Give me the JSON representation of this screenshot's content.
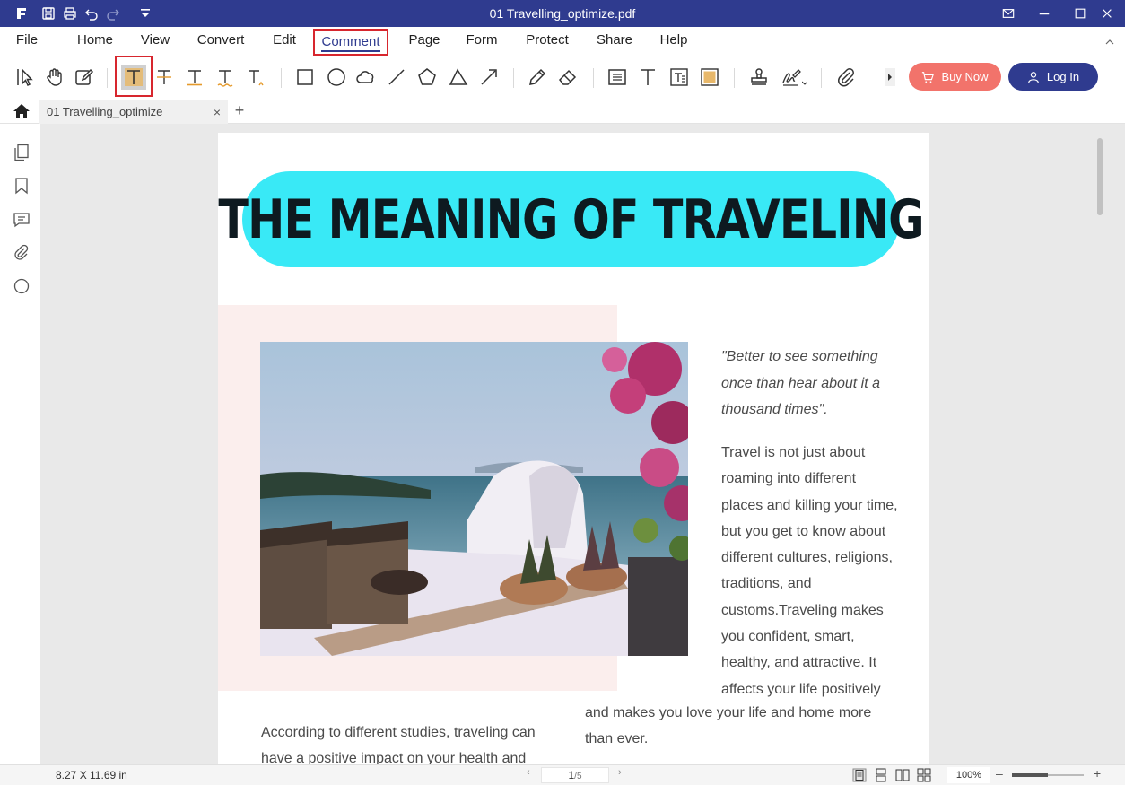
{
  "window": {
    "title": "01 Travelling_optimize.pdf"
  },
  "menu": {
    "items": [
      "File",
      "Home",
      "View",
      "Convert",
      "Edit",
      "Comment",
      "Page",
      "Form",
      "Protect",
      "Share",
      "Help"
    ],
    "active": "Comment"
  },
  "toolbar": {
    "buy_label": "Buy Now",
    "login_label": "Log In",
    "selected_tool": "highlight"
  },
  "tabs": {
    "doc_tab_label": "01 Travelling_optimize",
    "close_label": "×",
    "add_label": "+"
  },
  "document": {
    "headline": "THE MEANING OF TRAVELING",
    "quote": "\"Better to see something once than hear about it a thousand times\".",
    "para_right": "Travel is not just about roaming into different places and killing your time, but you get to know about different cultures, religions, traditions, and customs.Traveling makes you confident, smart, healthy, and attractive. It affects your life positively",
    "para_bottom_right": "and makes you love your life and home more than ever.",
    "para_bottom_left": "According to different studies, traveling can have a positive impact on your health and",
    "colors": {
      "pill": "#39e9f6",
      "pink_block": "#fbeeed"
    }
  },
  "status": {
    "page_size": "8.27 X 11.69 in",
    "current_page": "1",
    "total_pages": "/5",
    "zoom": "100%"
  },
  "colors": {
    "brand": "#2f3b8f",
    "buy": "#f2736b",
    "highlight_box": "#d7262e"
  }
}
